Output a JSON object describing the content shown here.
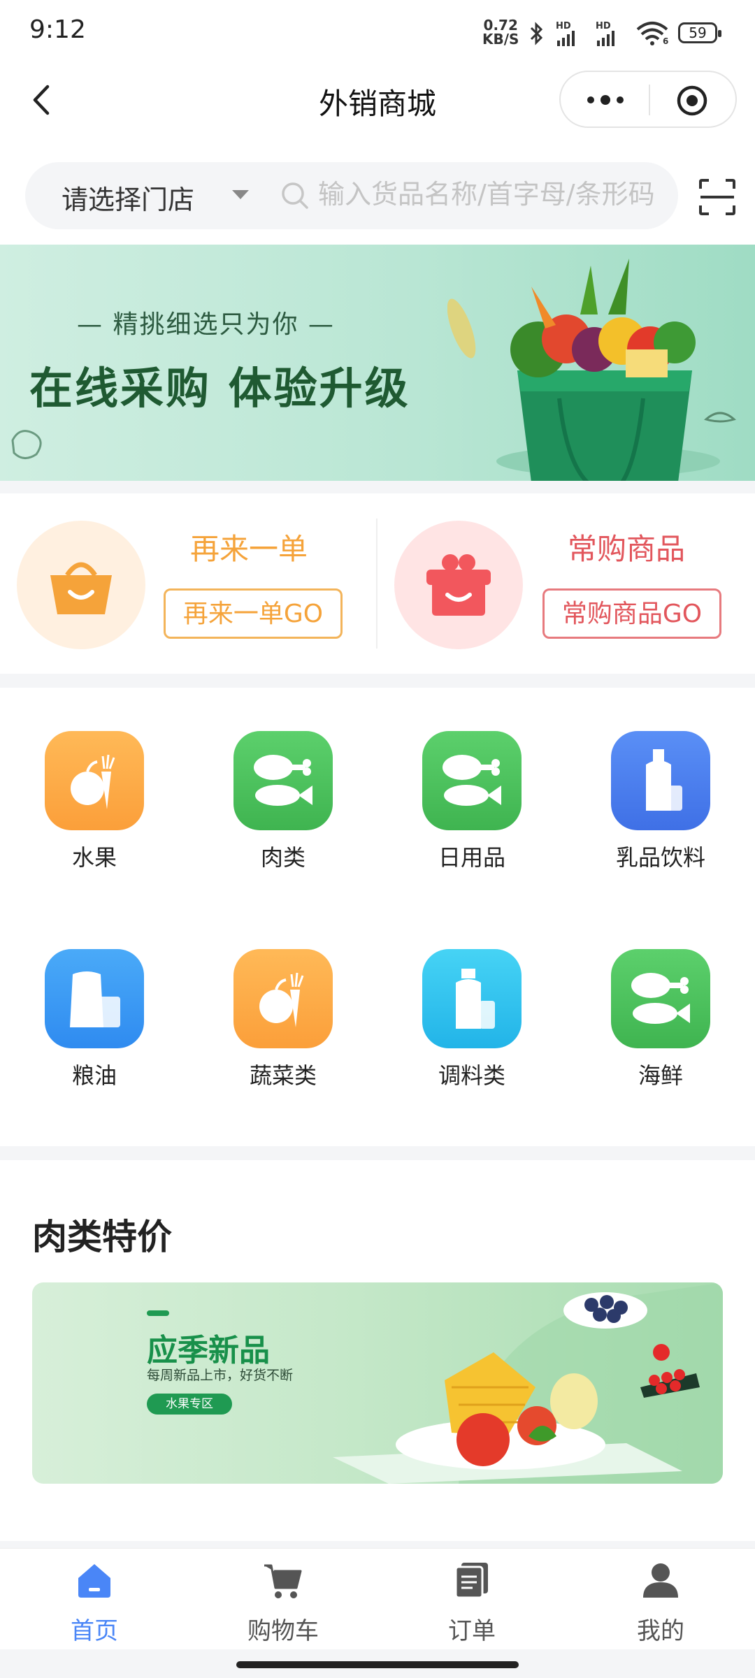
{
  "status_bar": {
    "time": "9:12",
    "net_speed_value": "0.72",
    "net_speed_unit": "KB/S",
    "battery": "59",
    "signal_label_1": "HD",
    "signal_label_2": "HD",
    "wifi_label": "6"
  },
  "header": {
    "title": "外销商城",
    "back_icon": "chevron-left-icon",
    "more_icon": "more-dots-icon",
    "target_icon": "target-icon"
  },
  "search": {
    "store_select": "请选择门店",
    "placeholder": "输入货品名称/首字母/条形码",
    "scan_icon": "scan-icon"
  },
  "banner": {
    "subtitle": "— 精挑细选只为你 —",
    "title": "在线采购 体验升级"
  },
  "quick_actions": [
    {
      "title": "再来一单",
      "button": "再来一单GO",
      "color": "#f5a33a",
      "bg": "#fff0e0",
      "icon": "shopping-basket-icon"
    },
    {
      "title": "常购商品",
      "button": "常购商品GO",
      "color": "#e2565c",
      "bg": "#ffe4e4",
      "icon": "gift-box-icon"
    }
  ],
  "categories": [
    {
      "label": "水果",
      "icon": "fruit-icon",
      "color": "#fba94a"
    },
    {
      "label": "肉类",
      "icon": "meat-fish-icon",
      "color": "#4fc15f"
    },
    {
      "label": "日用品",
      "icon": "meat-fish-icon",
      "color": "#4fc15f"
    },
    {
      "label": "乳品饮料",
      "icon": "bottle-icon",
      "color": "#4b7ff0"
    },
    {
      "label": "粮油",
      "icon": "grain-oil-icon",
      "color": "#3b9cf5"
    },
    {
      "label": "蔬菜类",
      "icon": "vegetable-icon",
      "color": "#fba94a"
    },
    {
      "label": "调料类",
      "icon": "seasoning-icon",
      "color": "#35c3ee"
    },
    {
      "label": "海鲜",
      "icon": "seafood-icon",
      "color": "#4fc15f"
    }
  ],
  "promo": {
    "section_title": "肉类特价",
    "banner_title": "应季新品",
    "banner_subtitle": "每周新品上市，好货不断",
    "banner_tag": "水果专区"
  },
  "tabs": [
    {
      "label": "首页",
      "icon": "home-icon",
      "active": true
    },
    {
      "label": "购物车",
      "icon": "cart-icon",
      "active": false
    },
    {
      "label": "订单",
      "icon": "order-icon",
      "active": false
    },
    {
      "label": "我的",
      "icon": "user-icon",
      "active": false
    }
  ],
  "colors": {
    "accent": "#4a86f7",
    "tab_inactive": "#555555"
  }
}
